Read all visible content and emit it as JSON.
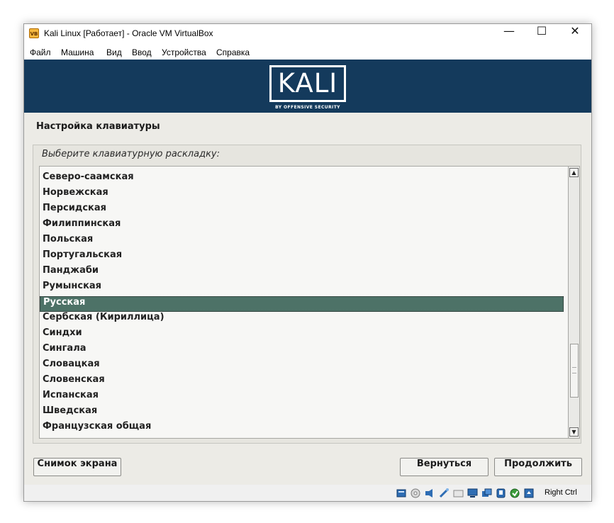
{
  "window": {
    "title": "Kali Linux [Работает] - Oracle VM VirtualBox",
    "controls": {
      "minimize": "—",
      "maximize": "☐",
      "close": "✕"
    }
  },
  "menubar": [
    "Файл",
    "Машина",
    "Вид",
    "Ввод",
    "Устройства",
    "Справка"
  ],
  "banner": {
    "logo_text": "KALI",
    "logo_subtitle": "BY OFFENSIVE SECURITY",
    "background": "#143a5c"
  },
  "installer": {
    "page_title": "Настройка клавиатуры",
    "prompt": "Выберите клавиатурную раскладку:",
    "layouts": [
      "Северо-саамская",
      "Норвежская",
      "Персидская",
      "Филиппинская",
      "Польская",
      "Португальская",
      "Панджаби",
      "Румынская",
      "Русская",
      "Сербская (Кириллица)",
      "Синдхи",
      "Сингала",
      "Словацкая",
      "Словенская",
      "Испанская",
      "Шведская",
      "Французская общая"
    ],
    "selected": "Русская",
    "selected_color": "#4d7267",
    "buttons": {
      "screenshot": "Снимок экрана",
      "back": "Вернуться",
      "continue": "Продолжить"
    }
  },
  "statusbar": {
    "icons": [
      "hard-disk-icon",
      "optical-disc-icon",
      "audio-icon",
      "network-icon",
      "shared-folder-icon",
      "display-icon",
      "video-capture-icon",
      "usb-icon",
      "virtualization-icon",
      "mouse-integration-icon"
    ],
    "host_key": "Right Ctrl"
  }
}
